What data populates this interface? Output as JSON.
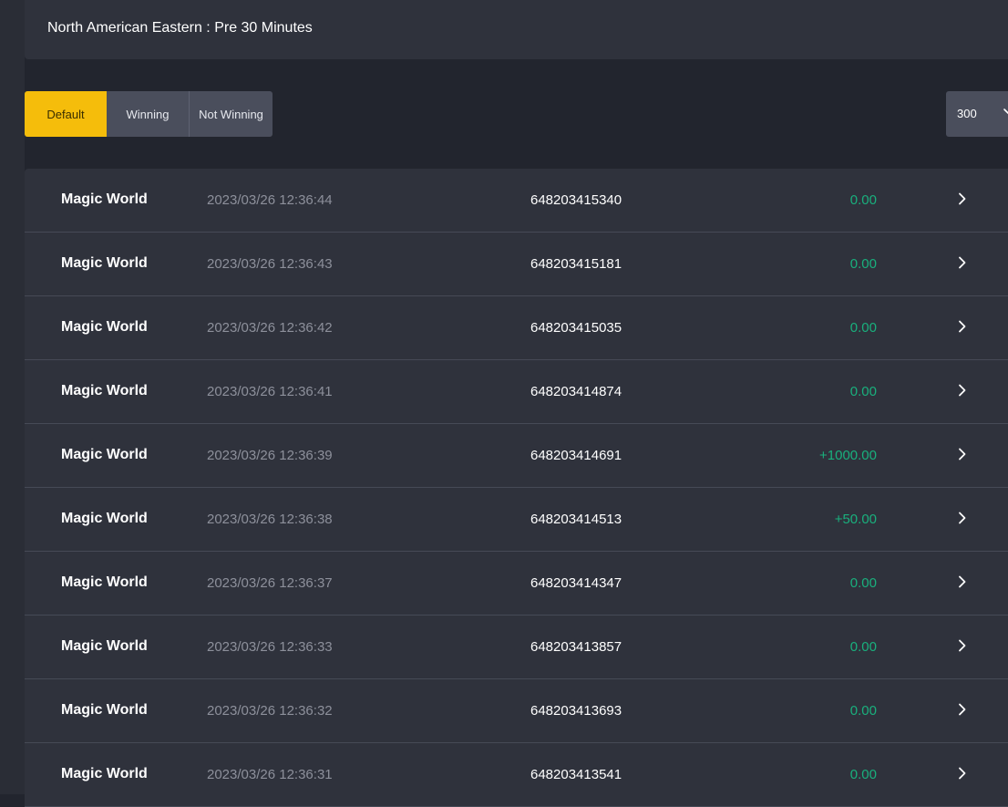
{
  "header": {
    "title": "North American Eastern : Pre 30 Minutes"
  },
  "filters": {
    "default_label": "Default",
    "winning_label": "Winning",
    "not_winning_label": "Not Winning",
    "active": "Default"
  },
  "page_size": {
    "value": "300"
  },
  "colors": {
    "accent": "#f5bd0b",
    "win_amount": "#19b07d",
    "background": "#22252e",
    "panel": "#2f323c"
  },
  "rows": [
    {
      "game": "Magic World",
      "time": "2023/03/26 12:36:44",
      "ticket": "648203415340",
      "amount": "0.00"
    },
    {
      "game": "Magic World",
      "time": "2023/03/26 12:36:43",
      "ticket": "648203415181",
      "amount": "0.00"
    },
    {
      "game": "Magic World",
      "time": "2023/03/26 12:36:42",
      "ticket": "648203415035",
      "amount": "0.00"
    },
    {
      "game": "Magic World",
      "time": "2023/03/26 12:36:41",
      "ticket": "648203414874",
      "amount": "0.00"
    },
    {
      "game": "Magic World",
      "time": "2023/03/26 12:36:39",
      "ticket": "648203414691",
      "amount": "+1000.00"
    },
    {
      "game": "Magic World",
      "time": "2023/03/26 12:36:38",
      "ticket": "648203414513",
      "amount": "+50.00"
    },
    {
      "game": "Magic World",
      "time": "2023/03/26 12:36:37",
      "ticket": "648203414347",
      "amount": "0.00"
    },
    {
      "game": "Magic World",
      "time": "2023/03/26 12:36:33",
      "ticket": "648203413857",
      "amount": "0.00"
    },
    {
      "game": "Magic World",
      "time": "2023/03/26 12:36:32",
      "ticket": "648203413693",
      "amount": "0.00"
    },
    {
      "game": "Magic World",
      "time": "2023/03/26 12:36:31",
      "ticket": "648203413541",
      "amount": "0.00"
    }
  ]
}
